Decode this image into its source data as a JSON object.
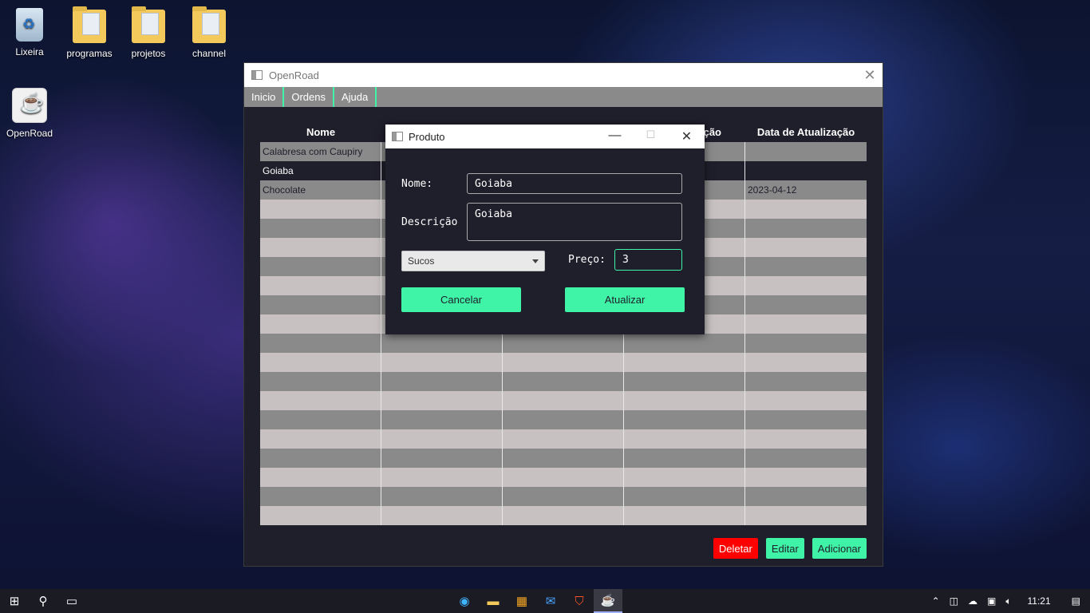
{
  "desktop": {
    "icons": [
      "Lixeira",
      "programas",
      "projetos",
      "channel",
      "OpenRoad"
    ]
  },
  "app": {
    "title": "OpenRoad",
    "menu": [
      "Inicio",
      "Ordens",
      "Ajuda"
    ],
    "table": {
      "headers": [
        "Nome",
        "",
        "",
        "ção",
        "Data de Atualização"
      ],
      "rows": [
        [
          "Calabresa com Caupiry",
          "",
          "",
          "",
          ""
        ],
        [
          "Goiaba",
          "",
          "",
          "",
          ""
        ],
        [
          "Chocolate",
          "",
          "",
          "",
          "2023-04-12"
        ]
      ]
    },
    "buttons": {
      "delete": "Deletar",
      "edit": "Editar",
      "add": "Adicionar"
    }
  },
  "dialog": {
    "title": "Produto",
    "labels": {
      "nome": "Nome:",
      "descricao": "Descrição",
      "preco": "Preço:"
    },
    "values": {
      "nome": "Goiaba",
      "descricao": "Goiaba",
      "categoria": "Sucos",
      "preco": "3"
    },
    "buttons": {
      "cancel": "Cancelar",
      "update": "Atualizar"
    }
  },
  "taskbar": {
    "time": "11:21"
  },
  "colors": {
    "accent": "#3ff4a6",
    "danger": "#ff0000",
    "panel": "#1f1e2b"
  }
}
